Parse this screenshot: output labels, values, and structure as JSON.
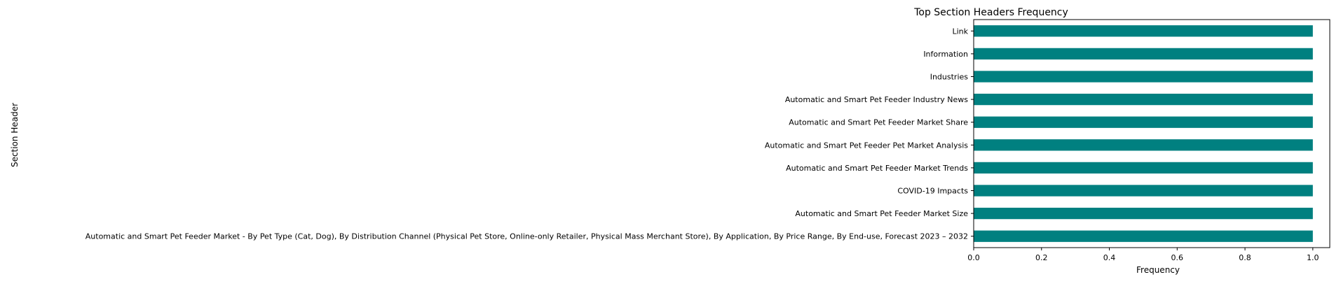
{
  "chart_data": {
    "type": "bar",
    "orientation": "horizontal",
    "title": "Top Section Headers Frequency",
    "xlabel": "Frequency",
    "ylabel": "Section Header",
    "xlim": [
      0,
      1.05
    ],
    "xticks": [
      "0.0",
      "0.2",
      "0.4",
      "0.6",
      "0.8",
      "1.0"
    ],
    "grid": false,
    "categories": [
      "Automatic and Smart Pet Feeder Market - By Pet Type (Cat, Dog), By Distribution Channel (Physical Pet Store, Online-only Retailer, Physical Mass Merchant Store), By Application, By Price Range, By End-use, Forecast 2023 – 2032",
      "Automatic and Smart Pet Feeder Market Size",
      "COVID-19 Impacts",
      "Automatic and Smart Pet Feeder Market Trends",
      "Automatic and Smart Pet Feeder Pet Market Analysis",
      "Automatic and Smart Pet Feeder Market Share",
      "Automatic and Smart Pet Feeder Industry News",
      "Industries",
      "Information",
      "Link"
    ],
    "values": [
      1,
      1,
      1,
      1,
      1,
      1,
      1,
      1,
      1,
      1
    ],
    "bar_color": "#008080"
  }
}
